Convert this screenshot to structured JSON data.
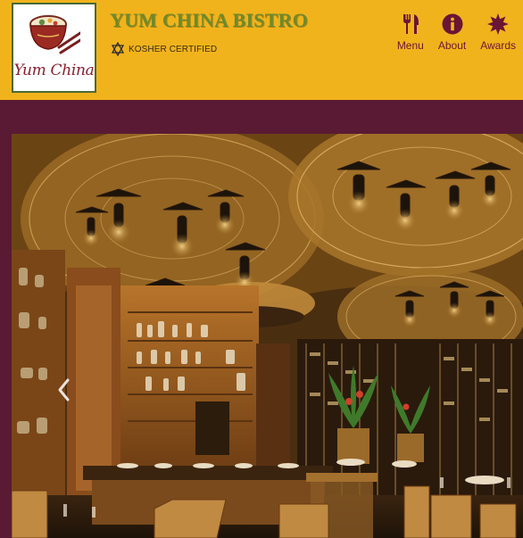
{
  "brand": {
    "logo_text": "Yum China",
    "title": "YUM CHINA BISTRO",
    "badge": "KOSHER CERTIFIED"
  },
  "nav": {
    "items": [
      {
        "label": "Menu",
        "icon": "fork-knife-icon"
      },
      {
        "label": "About",
        "icon": "info-icon"
      },
      {
        "label": "Awards",
        "icon": "award-burst-icon"
      }
    ]
  },
  "hero": {
    "image": "restaurant-interior-photo",
    "prev_icon": "chevron-left-icon"
  },
  "colors": {
    "header_bg": "#f1b31c",
    "band_bg": "#5a1a33",
    "title_green": "#6d8a2c",
    "nav_maroon": "#6b1534",
    "logo_red": "#8b1d2c"
  }
}
